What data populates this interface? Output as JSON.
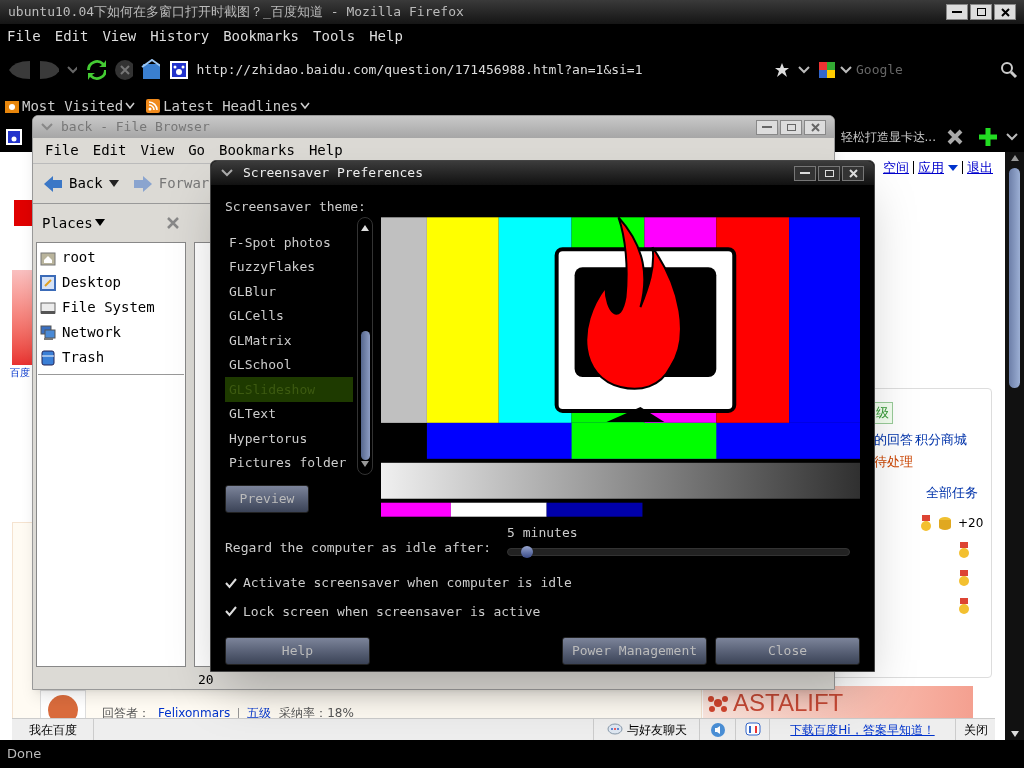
{
  "firefox": {
    "title": "ubuntu10.04下如何在多窗口打开时截图？_百度知道 - Mozilla Firefox",
    "menu": [
      "File",
      "Edit",
      "View",
      "History",
      "Bookmarks",
      "Tools",
      "Help"
    ],
    "url": "http://zhidao.baidu.com/question/171456988.html?an=1&si=1",
    "search": {
      "placeholder": "Google"
    },
    "bookmarks": [
      "Most Visited",
      "Latest Headlines"
    ],
    "tab": {
      "label": "轻松打造显卡达..."
    },
    "status": "Done"
  },
  "page": {
    "header_links": [
      "空间",
      "应用",
      "退出"
    ],
    "left_link": "百度",
    "task_box": {
      "level": "级",
      "links": [
        "的回答",
        "积分商城"
      ],
      "pending": "待处理",
      "all_tasks": "全部任务",
      "reward": "+20"
    },
    "answer": {
      "label": "回答者：",
      "user": "Felixonmars",
      "rank": "五级",
      "rate": "采纳率：18%"
    },
    "ad": "ASTALIFT",
    "bottom_bar": {
      "home": "我在百度",
      "chat": "与好友聊天",
      "download": "下载百度Hi，答案早知道！",
      "close": "关闭"
    }
  },
  "file_browser": {
    "title": "back - File Browser",
    "menu": [
      "File",
      "Edit",
      "View",
      "Go",
      "Bookmarks",
      "Help"
    ],
    "back": "Back",
    "forward": "Forwar",
    "places": "Places",
    "sidebar": [
      {
        "label": "root",
        "kind": "home"
      },
      {
        "label": "Desktop",
        "kind": "desktop"
      },
      {
        "label": "File System",
        "kind": "drive"
      },
      {
        "label": "Network",
        "kind": "network"
      },
      {
        "label": "Trash",
        "kind": "trash"
      }
    ],
    "status": "20"
  },
  "dialog": {
    "title": "Screensaver Preferences",
    "theme_label": "Screensaver theme:",
    "themes": [
      {
        "label": "F-Spot photos",
        "selected": false
      },
      {
        "label": "FuzzyFlakes",
        "selected": false
      },
      {
        "label": "GLBlur",
        "selected": false
      },
      {
        "label": "GLCells",
        "selected": false
      },
      {
        "label": "GLMatrix",
        "selected": false
      },
      {
        "label": "GLSchool",
        "selected": false
      },
      {
        "label": "GLSlideshow",
        "selected": true
      },
      {
        "label": "GLText",
        "selected": false
      },
      {
        "label": "Hypertorus",
        "selected": false
      },
      {
        "label": "Pictures folder",
        "selected": false
      }
    ],
    "preview": "Preview",
    "idle_label": "Regard the computer as idle after:",
    "idle_value": "5 minutes",
    "idle": {
      "level": 0.04
    },
    "options": [
      {
        "label": "Activate screensaver when computer is idle",
        "checked": true
      },
      {
        "label": "Lock screen when screensaver is active",
        "checked": true
      }
    ],
    "buttons": [
      "Help",
      "Power Management",
      "Close"
    ]
  }
}
